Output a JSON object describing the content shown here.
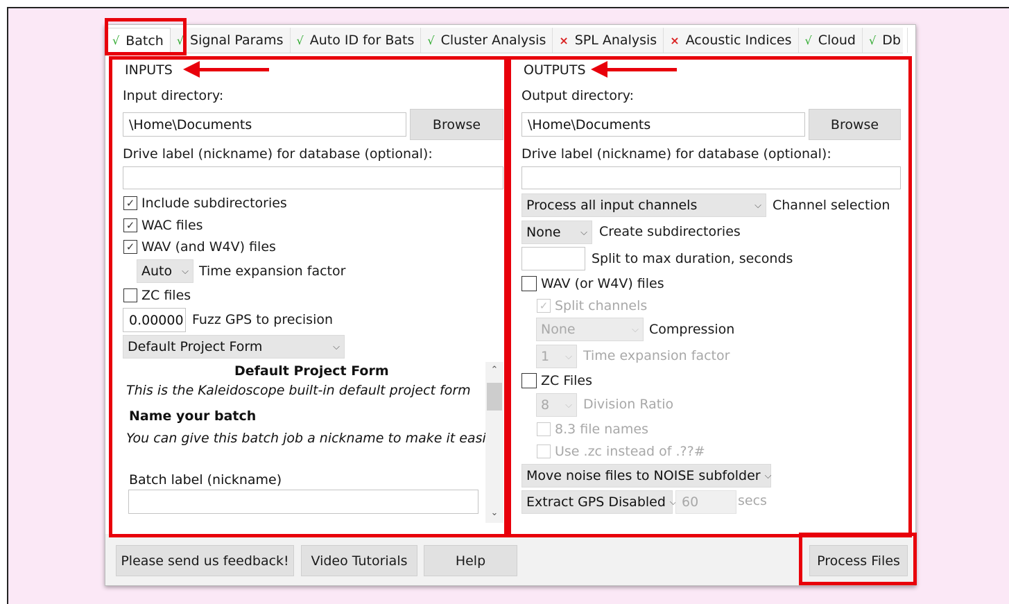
{
  "tabs": [
    {
      "label": "Batch",
      "status": "ok"
    },
    {
      "label": "Signal Params",
      "status": "ok"
    },
    {
      "label": "Auto ID for Bats",
      "status": "ok"
    },
    {
      "label": "Cluster Analysis",
      "status": "ok"
    },
    {
      "label": "SPL Analysis",
      "status": "error"
    },
    {
      "label": "Acoustic Indices",
      "status": "error"
    },
    {
      "label": "Cloud",
      "status": "ok"
    },
    {
      "label": "Db",
      "status": "ok"
    }
  ],
  "status_marks": {
    "ok": "√",
    "error": "×"
  },
  "colors": {
    "highlight_red": "#e8000b",
    "ok_green": "#2eaa2e",
    "error_red": "#d92020",
    "page_bg": "#fbe8f6"
  },
  "inputs": {
    "heading": "INPUTS",
    "dir_label": "Input directory:",
    "dir_value": "\\Home\\Documents",
    "browse_label": "Browse",
    "drive_label": "Drive label (nickname) for database (optional):",
    "drive_value": "",
    "include_subdirs": {
      "label": "Include subdirectories",
      "checked": true
    },
    "wac_files": {
      "label": "WAC files",
      "checked": true
    },
    "wav_files": {
      "label": "WAV (and W4V) files",
      "checked": true
    },
    "time_expansion": {
      "value": "Auto",
      "label": "Time expansion factor"
    },
    "zc_files": {
      "label": "ZC files",
      "checked": false
    },
    "fuzz_gps": {
      "value": "0.00000",
      "label": "Fuzz GPS to precision"
    },
    "project_form_select": "Default Project Form",
    "form_title": "Default Project Form",
    "form_subtitle": "This is the Kaleidoscope built-in default project form",
    "form_section_title": "Name your batch",
    "form_section_desc": "You can give this batch job a nickname to make it easier",
    "batch_label": "Batch label (nickname)",
    "batch_value": ""
  },
  "outputs": {
    "heading": "OUTPUTS",
    "dir_label": "Output directory:",
    "dir_value": "\\Home\\Documents",
    "browse_label": "Browse",
    "drive_label": "Drive label (nickname) for database (optional):",
    "drive_value": "",
    "channels_select": "Process all input channels",
    "channels_label": "Channel selection",
    "subdirs_select": "None",
    "subdirs_label": "Create subdirectories",
    "split_value": "",
    "split_label": "Split to max duration, seconds",
    "wav_files": {
      "label": "WAV (or W4V) files",
      "checked": false
    },
    "split_channels": {
      "label": "Split channels",
      "checked": true
    },
    "compression_select": "None",
    "compression_label": "Compression",
    "time_exp_select": "1",
    "time_exp_label": "Time expansion factor",
    "zc_files": {
      "label": "ZC Files",
      "checked": false
    },
    "division_select": "8",
    "division_label": "Division Ratio",
    "names83": {
      "label": "8.3 file names",
      "checked": false
    },
    "use_zc": {
      "label": "Use .zc instead of .??#",
      "checked": false
    },
    "noise_select": "Move noise files to NOISE subfolder",
    "gps_select": "Extract GPS Disabled",
    "gps_secs_value": "60",
    "gps_secs_label": "secs"
  },
  "footer": {
    "feedback": "Please send us feedback!",
    "tutorials": "Video Tutorials",
    "help": "Help",
    "process": "Process Files"
  },
  "icons": {
    "check": "✓",
    "chevron": "⌵",
    "scroll_up": "⌃",
    "scroll_down": "⌄"
  }
}
